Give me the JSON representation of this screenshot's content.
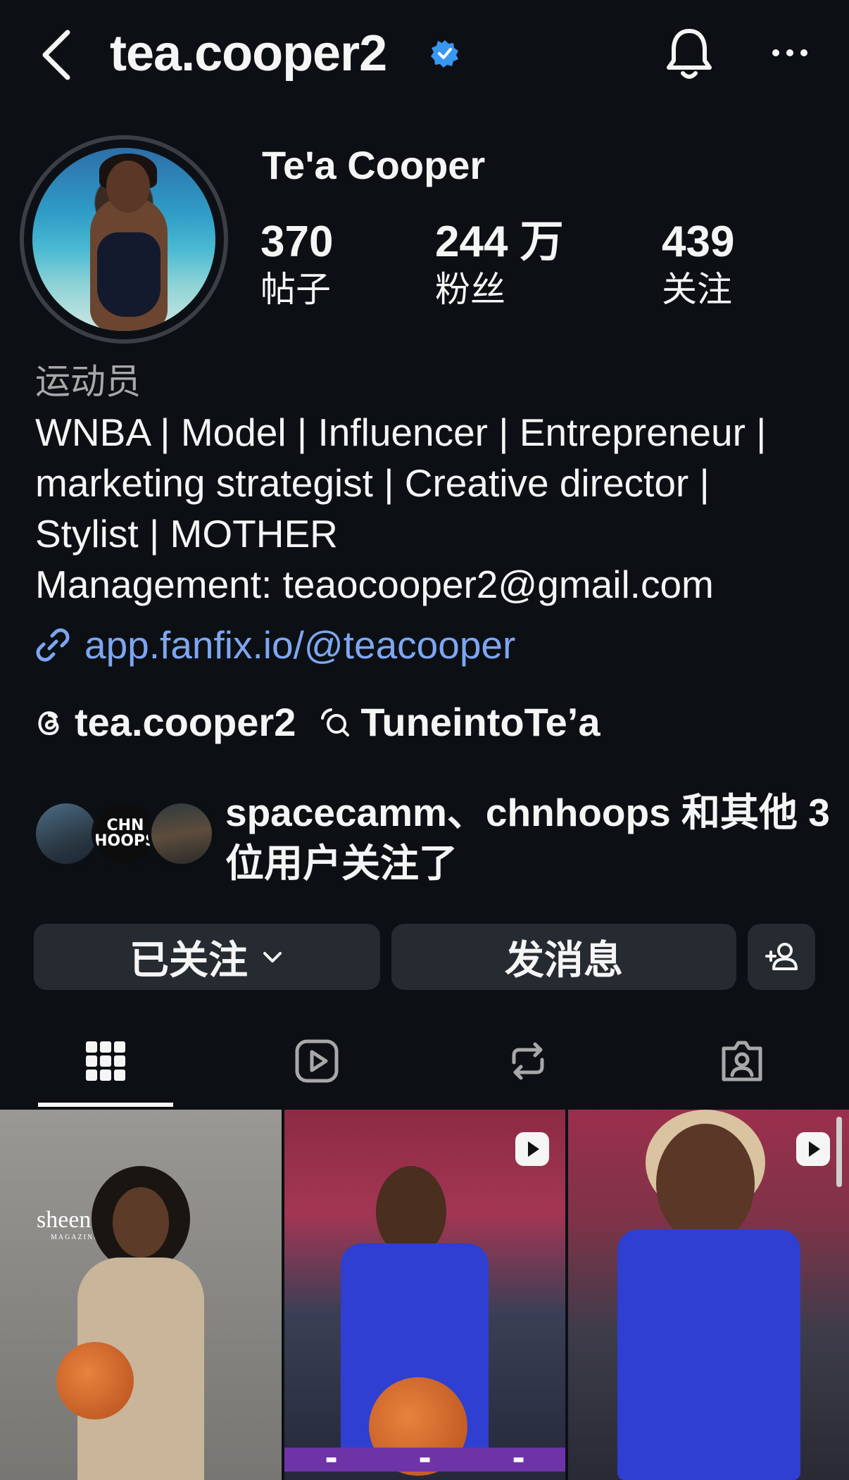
{
  "header": {
    "username": "tea.cooper2",
    "verified": true,
    "icons": [
      "back-arrow-icon",
      "verified-badge-icon",
      "bell-icon",
      "more-icon"
    ]
  },
  "profile": {
    "display_name": "Te'a Cooper",
    "stats": {
      "posts_value": "370",
      "posts_label": "帖子",
      "followers_value": "244 万",
      "followers_label": "粉丝",
      "following_value": "439",
      "following_label": "关注"
    },
    "category": "运动员",
    "bio_lines": [
      "WNBA | Model | Influencer | Entrepreneur |",
      "marketing strategist | Creative director |",
      "Stylist | MOTHER",
      "Management: teaocooper2@gmail.com"
    ],
    "link": "app.fanfix.io/@teacooper",
    "threads_handle": "tea.cooper2",
    "channel_name": "TuneintoTe’a",
    "mutual_text": "spacecamm、chnhoops 和其他 3 位用户关注了",
    "mutual_avatar_text": "CHN HOOPS"
  },
  "actions": {
    "following_label": "已关注",
    "message_label": "发消息"
  },
  "tabs": [
    "grid-icon",
    "reels-icon",
    "reposts-icon",
    "tagged-icon"
  ],
  "grid": {
    "tile1_brand": "sheen",
    "tile1_brand_sub": "MAGAZINE"
  },
  "colors": {
    "background": "#0c1014",
    "button": "#262b31",
    "link": "#7ea6f2",
    "verified": "#3897f0",
    "muted": "#a8a8a8"
  }
}
